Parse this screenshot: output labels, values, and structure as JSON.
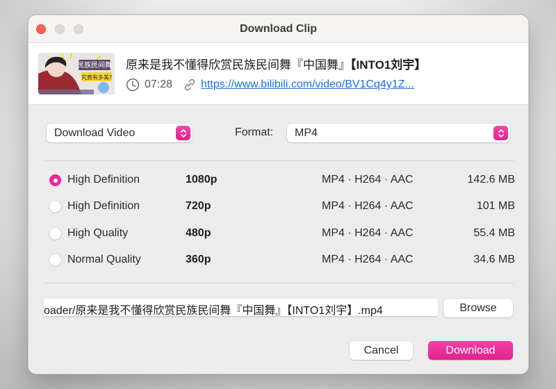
{
  "window": {
    "title": "Download Clip"
  },
  "video": {
    "title_prefix": "原来是我不懂得欣赏民族民间舞『中国舞』",
    "title_suffix": "【INTO1刘宇】",
    "duration": "07:28",
    "url": "https://www.bilibili.com/video/BV1Cq4y1Z...",
    "thumbnail": {
      "caption_top": "民族民间舞",
      "caption_mid": "究竟有多美?"
    }
  },
  "controls": {
    "mode_select": {
      "value": "Download Video"
    },
    "format_label": "Format:",
    "format_select": {
      "value": "MP4"
    }
  },
  "options": [
    {
      "label": "High Definition",
      "resolution": "1080p",
      "codec": "MP4 · H264 · AAC",
      "size": "142.6 MB",
      "selected": true
    },
    {
      "label": "High Definition",
      "resolution": "720p",
      "codec": "MP4 · H264 · AAC",
      "size": "101 MB",
      "selected": false
    },
    {
      "label": "High Quality",
      "resolution": "480p",
      "codec": "MP4 · H264 · AAC",
      "size": "55.4 MB",
      "selected": false
    },
    {
      "label": "Normal Quality",
      "resolution": "360p",
      "codec": "MP4 · H264 · AAC",
      "size": "34.6 MB",
      "selected": false
    }
  ],
  "save_path": {
    "value": "oader/原来是我不懂得欣赏民族民间舞『中国舞』【INTO1刘宇】.mp4"
  },
  "buttons": {
    "browse": "Browse",
    "cancel": "Cancel",
    "download": "Download"
  },
  "colors": {
    "accent": "#e8279a",
    "link": "#1a6fe0",
    "close_button": "#fe5f57"
  },
  "icons": {
    "duration": "clock-icon",
    "url": "link-icon",
    "select_stepper": "chevron-up-down-icon"
  }
}
